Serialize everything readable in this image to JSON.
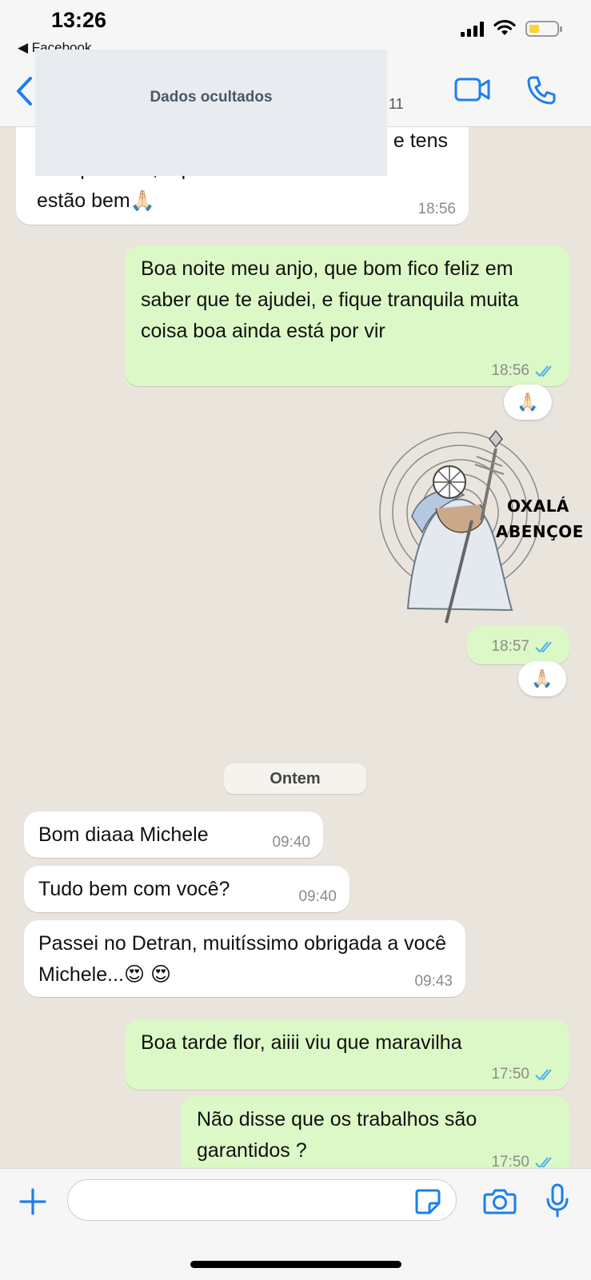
{
  "status_bar": {
    "time": "13:26",
    "back_app": "◀ Facebook"
  },
  "header": {
    "hidden_label": "Dados ocultados",
    "partial_count": "11"
  },
  "messages": {
    "m1_line1": "e tens",
    "m1_line2": "feito por mim, aqui em casa as coisas",
    "m1_line3": "estão bem🙏🏻",
    "m1_time": "18:56",
    "m2_text": "Boa noite meu anjo, que bom fico feliz em saber que te ajudei, e fique tranquila muita coisa boa ainda está por vir",
    "m2_time": "18:56",
    "m2_reaction": "🙏🏻",
    "sticker_line1": "OXALÁ",
    "sticker_line2": "ABENÇOE",
    "m3_time": "18:57",
    "m3_reaction": "🙏🏻",
    "date_chip": "Ontem",
    "m4_text": "Bom diaaa Michele",
    "m4_time": "09:40",
    "m5_text": "Tudo bem com você?",
    "m5_time": "09:40",
    "m6_text": "Passei no Detran, muitíssimo obrigada a você Michele...😍 😍",
    "m6_time": "09:43",
    "m7_text": "Boa tarde flor, aiiii viu que maravilha",
    "m7_time": "17:50",
    "m8_text": "Não disse que os trabalhos são garantidos ?",
    "m8_time": "17:50"
  },
  "input": {
    "value": "",
    "placeholder": ""
  },
  "colors": {
    "accent": "#1b7ff0",
    "outgoing_bubble": "#dcf8c6",
    "incoming_bubble": "#ffffff",
    "chat_background": "#e9e4dc",
    "read_ticks": "#4fb0e6"
  },
  "icons": [
    "back-chevron-icon",
    "video-call-icon",
    "phone-icon",
    "plus-icon",
    "sticker-icon",
    "camera-icon",
    "microphone-icon",
    "double-check-icon",
    "wifi-icon",
    "signal-icon",
    "battery-icon"
  ]
}
